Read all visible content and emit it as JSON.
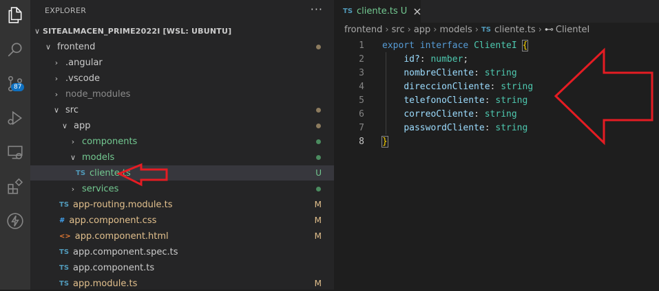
{
  "activity_bar": {
    "icons": [
      "explorer-icon",
      "search-icon",
      "source-control-icon",
      "run-debug-icon",
      "remote-explorer-icon",
      "extensions-icon",
      "lightning-icon"
    ],
    "source_control_badge": "87"
  },
  "sidebar": {
    "header": "EXPLORER",
    "more_actions": "···",
    "root_label": "SITEALMACEN_PRIME2022I [WSL: UBUNTU]",
    "items": [
      {
        "label": "frontend",
        "chevron": "∨",
        "icon": "",
        "status": "dot",
        "color": "#cccccc"
      },
      {
        "label": ".angular",
        "chevron": "›",
        "icon": "",
        "status": "",
        "color": "#cccccc"
      },
      {
        "label": ".vscode",
        "chevron": "›",
        "icon": "",
        "status": "",
        "color": "#cccccc"
      },
      {
        "label": "node_modules",
        "chevron": "›",
        "icon": "",
        "status": "",
        "color": "#8c8c8c"
      },
      {
        "label": "src",
        "chevron": "∨",
        "icon": "",
        "status": "dot",
        "color": "#cccccc"
      },
      {
        "label": "app",
        "chevron": "∨",
        "icon": "",
        "status": "dot",
        "color": "#cccccc"
      },
      {
        "label": "components",
        "chevron": "›",
        "icon": "",
        "status": "dot-green",
        "color": "#73c991"
      },
      {
        "label": "models",
        "chevron": "∨",
        "icon": "",
        "status": "dot-green",
        "color": "#73c991"
      },
      {
        "label": "cliente.ts",
        "chevron": "",
        "icon": "TS",
        "status": "U",
        "color": "#73c991"
      },
      {
        "label": "services",
        "chevron": "›",
        "icon": "",
        "status": "dot-green",
        "color": "#73c991"
      },
      {
        "label": "app-routing.module.ts",
        "chevron": "",
        "icon": "TS",
        "status": "M",
        "color": "#e2c08d"
      },
      {
        "label": "app.component.css",
        "chevron": "",
        "icon": "#",
        "status": "M",
        "color": "#e2c08d"
      },
      {
        "label": "app.component.html",
        "chevron": "",
        "icon": "<>",
        "status": "M",
        "color": "#e2c08d"
      },
      {
        "label": "app.component.spec.ts",
        "chevron": "",
        "icon": "TS",
        "status": "",
        "color": "#cccccc"
      },
      {
        "label": "app.component.ts",
        "chevron": "",
        "icon": "TS",
        "status": "",
        "color": "#cccccc"
      },
      {
        "label": "app.module.ts",
        "chevron": "",
        "icon": "TS",
        "status": "M",
        "color": "#e2c08d"
      }
    ]
  },
  "editor": {
    "tab": {
      "icon": "TS",
      "label": "cliente.ts",
      "status": "U",
      "close": "×"
    },
    "breadcrumb": {
      "parts": [
        "frontend",
        "src",
        "app",
        "models"
      ],
      "file_icon": "TS",
      "file": "cliente.ts",
      "symbol": "ClienteI"
    },
    "code": {
      "line_numbers": [
        "1",
        "2",
        "3",
        "4",
        "5",
        "6",
        "7",
        "8"
      ],
      "line1": {
        "kw1": "export",
        "kw2": "interface",
        "name": "ClienteI",
        "brace": "{"
      },
      "props": [
        {
          "name": "id?",
          "type": "number",
          "end": ";"
        },
        {
          "name": "nombreCliente",
          "type": "string",
          "end": ""
        },
        {
          "name": "direccionCliente",
          "type": "string",
          "end": ""
        },
        {
          "name": "telefonoCliente",
          "type": "string",
          "end": ""
        },
        {
          "name": "correoCliente",
          "type": "string",
          "end": ""
        },
        {
          "name": "passwordCliente",
          "type": "string",
          "end": ""
        }
      ],
      "line8": {
        "brace": "}"
      }
    }
  },
  "colors": {
    "annotation": "#e51c23",
    "ts": "#519aba",
    "css": "#42a5f5",
    "html": "#e37933",
    "modified": "#e2c08d",
    "untracked": "#73c991"
  }
}
